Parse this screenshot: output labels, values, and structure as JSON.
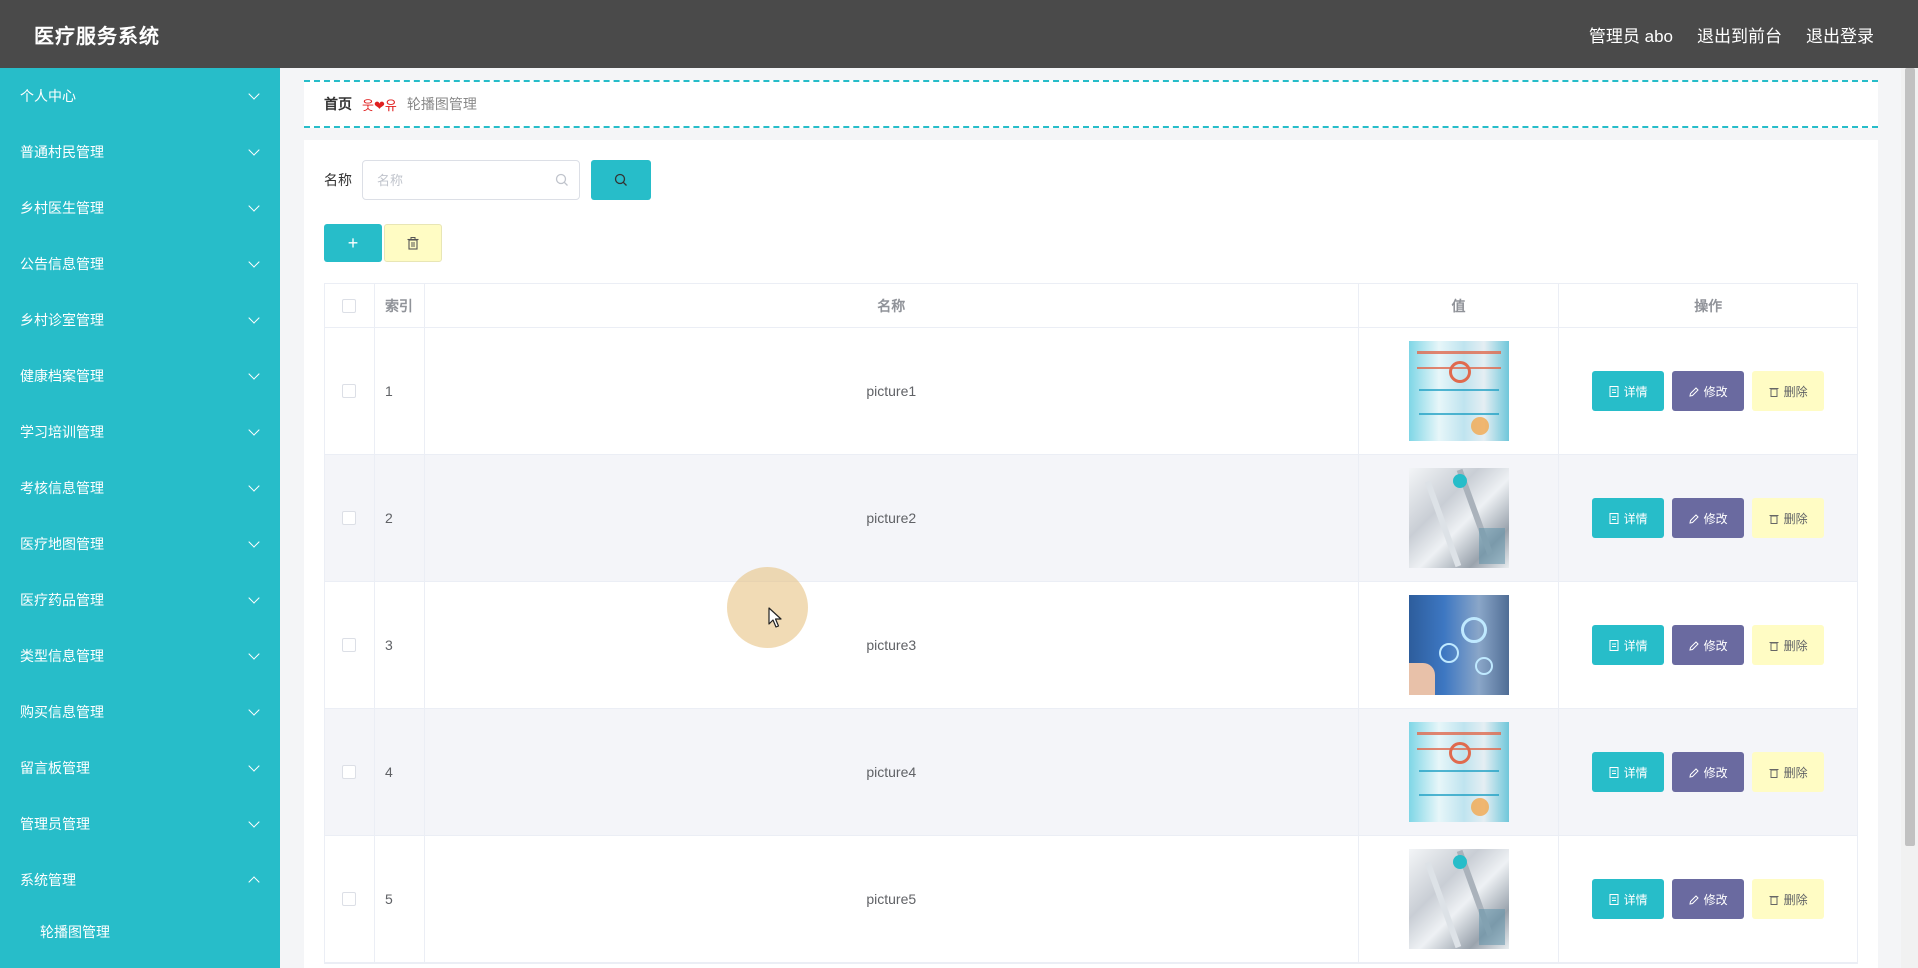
{
  "app": {
    "title": "医疗服务系统",
    "user_label": "管理员 abo",
    "back_to_front": "退出到前台",
    "logout": "退出登录"
  },
  "sidebar": {
    "items": [
      {
        "label": "个人中心",
        "expanded": false
      },
      {
        "label": "普通村民管理",
        "expanded": false
      },
      {
        "label": "乡村医生管理",
        "expanded": false
      },
      {
        "label": "公告信息管理",
        "expanded": false
      },
      {
        "label": "乡村诊室管理",
        "expanded": false
      },
      {
        "label": "健康档案管理",
        "expanded": false
      },
      {
        "label": "学习培训管理",
        "expanded": false
      },
      {
        "label": "考核信息管理",
        "expanded": false
      },
      {
        "label": "医疗地图管理",
        "expanded": false
      },
      {
        "label": "医疗药品管理",
        "expanded": false
      },
      {
        "label": "类型信息管理",
        "expanded": false
      },
      {
        "label": "购买信息管理",
        "expanded": false
      },
      {
        "label": "留言板管理",
        "expanded": false
      },
      {
        "label": "管理员管理",
        "expanded": false
      },
      {
        "label": "系统管理",
        "expanded": true
      }
    ],
    "sub_items": [
      {
        "label": "轮播图管理"
      }
    ]
  },
  "breadcrumb": {
    "home": "首页",
    "separator": "웃❤유",
    "current": "轮播图管理"
  },
  "search": {
    "label": "名称",
    "placeholder": "名称",
    "value": ""
  },
  "table": {
    "columns": [
      "索引",
      "名称",
      "值",
      "操作"
    ],
    "rows": [
      {
        "index": "1",
        "name": "picture1",
        "image": "medical-collage-teal"
      },
      {
        "index": "2",
        "name": "picture2",
        "image": "medical-corridor-white"
      },
      {
        "index": "3",
        "name": "picture3",
        "image": "medical-hand-blue"
      },
      {
        "index": "4",
        "name": "picture4",
        "image": "medical-collage-teal"
      },
      {
        "index": "5",
        "name": "picture5",
        "image": "medical-corridor-white"
      }
    ],
    "actions": {
      "detail": "详情",
      "edit": "修改",
      "delete": "删除"
    }
  },
  "colors": {
    "topbar": "#4a4a4a",
    "accent": "#27bdc9",
    "edit": "#6a6aa0",
    "delete": "#fffcc4"
  },
  "icons": [
    "search-icon",
    "plus-icon",
    "trash-icon",
    "document-icon",
    "pencil-icon",
    "chevron-down-icon",
    "chevron-up-icon"
  ]
}
